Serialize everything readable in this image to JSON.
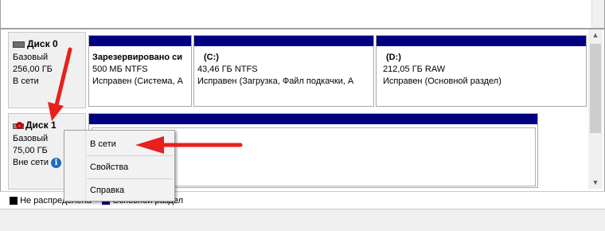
{
  "disks": [
    {
      "title": "Диск 0",
      "type": "Базовый",
      "size": "256,00 ГБ",
      "status": "В сети"
    },
    {
      "title": "Диск 1",
      "type": "Базовый",
      "size": "75,00 ГБ",
      "status": "Вне сети"
    }
  ],
  "partitions": [
    {
      "name": "Зарезервировано си",
      "size_fs": "500 МБ NTFS",
      "health": "Исправен (Система, А"
    },
    {
      "name": "(C:)",
      "size_fs": "43,46 ГБ NTFS",
      "health": "Исправен (Загрузка, Файл подкачки, А"
    },
    {
      "name": "(D:)",
      "size_fs": "212,05 ГБ RAW",
      "health": "Исправен (Основной раздел)"
    }
  ],
  "context_menu": {
    "items": [
      {
        "label": "В сети"
      },
      {
        "label": "Свойства"
      },
      {
        "label": "Справка"
      }
    ]
  },
  "legend": {
    "items": [
      {
        "label": "Не распределена",
        "color": "#000000"
      },
      {
        "label": "Основной раздел",
        "color": "#000080"
      }
    ]
  },
  "annotation_color": "#e8201e",
  "icons": [
    "disk-icon",
    "disk-offline-icon",
    "info-icon",
    "scroll-up-icon",
    "scroll-down-icon"
  ]
}
